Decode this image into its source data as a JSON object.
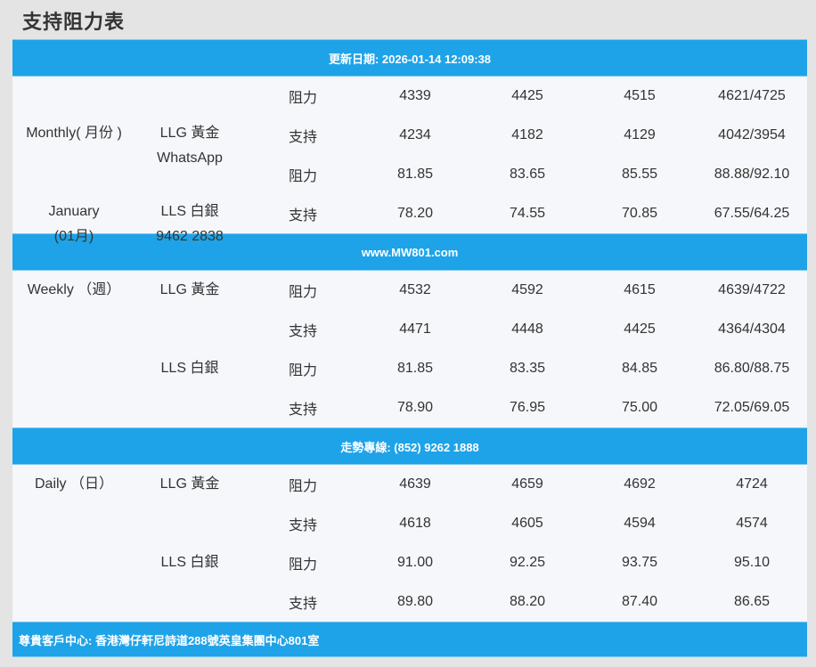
{
  "page_title": "支持阻力表",
  "bands": {
    "date": "更新日期: 2026-01-14 12:09:38",
    "site": "www.MW801.com",
    "hotline": "走勢專線: (852) 9262 1888",
    "address": "尊貴客戶中心: 香港灣仔軒尼詩道288號英皇集團中心801室"
  },
  "monthly": {
    "period_line1": "Monthly( 月份 )",
    "period_line2": "January",
    "period_line3": "(01月)",
    "llg_label": "LLG 黃金",
    "llg_sub": "WhatsApp",
    "lls_label": "LLS 白銀",
    "lls_sub": "9462 2838",
    "rows": [
      {
        "type": "阻力",
        "v1": "4339",
        "v2": "4425",
        "v3": "4515",
        "v4": "4621/4725"
      },
      {
        "type": "支持",
        "v1": "4234",
        "v2": "4182",
        "v3": "4129",
        "v4": "4042/3954"
      },
      {
        "type": "阻力",
        "v1": "81.85",
        "v2": "83.65",
        "v3": "85.55",
        "v4": "88.88/92.10"
      },
      {
        "type": "支持",
        "v1": "78.20",
        "v2": "74.55",
        "v3": "70.85",
        "v4": "67.55/64.25"
      }
    ]
  },
  "weekly": {
    "period_line1": "Weekly （週）",
    "llg_label": "LLG 黃金",
    "lls_label": "LLS 白銀",
    "rows": [
      {
        "type": "阻力",
        "v1": "4532",
        "v2": "4592",
        "v3": "4615",
        "v4": "4639/4722"
      },
      {
        "type": "支持",
        "v1": "4471",
        "v2": "4448",
        "v3": "4425",
        "v4": "4364/4304"
      },
      {
        "type": "阻力",
        "v1": "81.85",
        "v2": "83.35",
        "v3": "84.85",
        "v4": "86.80/88.75"
      },
      {
        "type": "支持",
        "v1": "78.90",
        "v2": "76.95",
        "v3": "75.00",
        "v4": "72.05/69.05"
      }
    ]
  },
  "daily": {
    "period_line1": "Daily （日）",
    "llg_label": "LLG 黃金",
    "lls_label": "LLS 白銀",
    "rows": [
      {
        "type": "阻力",
        "v1": "4639",
        "v2": "4659",
        "v3": "4692",
        "v4": "4724"
      },
      {
        "type": "支持",
        "v1": "4618",
        "v2": "4605",
        "v3": "4594",
        "v4": "4574"
      },
      {
        "type": "阻力",
        "v1": "91.00",
        "v2": "92.25",
        "v3": "93.75",
        "v4": "95.10"
      },
      {
        "type": "支持",
        "v1": "89.80",
        "v2": "88.20",
        "v3": "87.40",
        "v4": "86.65"
      }
    ]
  },
  "colors": {
    "band_blue": "#1ea3e8",
    "row_bg": "#f5f7fa",
    "page_bg": "#e4e4e4"
  }
}
